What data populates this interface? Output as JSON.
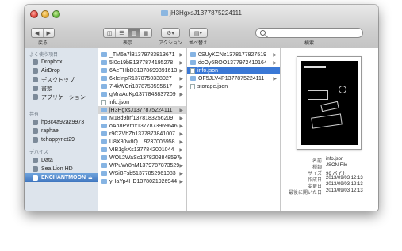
{
  "window": {
    "title": "jH3HgxsJ1377875224111"
  },
  "toolbar": {
    "back_label": "戻る",
    "view_label": "表示",
    "action_label": "アクション",
    "arrange_label": "並べ替え",
    "search_label": "検索",
    "search_placeholder": "",
    "view_buttons": [
      "◫",
      "☰",
      "▥",
      "▦"
    ],
    "view_active_index": 2
  },
  "sidebar": {
    "favorites_header": "よく使う項目",
    "favorites": [
      "Dropbox",
      "AirDrop",
      "デスクトップ",
      "書類",
      "アプリケーション"
    ],
    "shared_header": "共有",
    "shared": [
      "hp3c4a92aa9973",
      "raphael",
      "tchappynet29"
    ],
    "devices_header": "デバイス",
    "devices": [
      "Data",
      "Sea Lion HD",
      "ENCHANTMOON"
    ],
    "selected": "ENCHANTMOON",
    "eject_icon": "⏏"
  },
  "column1": [
    {
      "name": "_TM6a7lB1379783813671",
      "type": "folder"
    },
    {
      "name": "5I0c19bE1377874195278",
      "type": "folder"
    },
    {
      "name": "6AeTHbD31378699391613",
      "type": "folder"
    },
    {
      "name": "6xIeInpR1378750338027",
      "type": "folder"
    },
    {
      "name": "7j4kWCri1378750595617",
      "type": "folder"
    },
    {
      "name": "gMraAuKp1377843837209",
      "type": "folder"
    },
    {
      "name": "info.json",
      "type": "file"
    },
    {
      "name": "jH3HgxsJ1377875224111",
      "type": "folder",
      "selected": "gray"
    },
    {
      "name": "M18d9brf1378183256209",
      "type": "folder"
    },
    {
      "name": "oAh8PVmx1377873969646",
      "type": "folder"
    },
    {
      "name": "r9CZVbZb1377873841007",
      "type": "folder"
    },
    {
      "name": "U8X80w8Q....9237005958",
      "type": "folder"
    },
    {
      "name": "VIB1gkXs1377842001044",
      "type": "folder"
    },
    {
      "name": "WOL2WaSc1378203848597",
      "type": "folder"
    },
    {
      "name": "WPuWr8hM1379787873529",
      "type": "folder"
    },
    {
      "name": "WSiBFsb51377852961083",
      "type": "folder"
    },
    {
      "name": "yHaYp4HD1378021926944",
      "type": "folder"
    }
  ],
  "column2": [
    {
      "name": "0SUyKCNz1378177827519",
      "type": "folder"
    },
    {
      "name": "dcOy6ROO1377972410164",
      "type": "folder"
    },
    {
      "name": "info.json",
      "type": "file",
      "selected": "blue"
    },
    {
      "name": "OF5JLV4P1377875224111",
      "type": "folder"
    },
    {
      "name": "storage.json",
      "type": "file"
    }
  ],
  "preview": {
    "keys": [
      "名前",
      "種類",
      "サイズ",
      "作成日",
      "変更日",
      "最後に開いた日"
    ],
    "values": [
      "info.json",
      "JSON File",
      "96 バイト",
      "2013/09/03 12:13",
      "2013/09/03 12:13",
      "2013/09/03 12:13"
    ]
  },
  "colors": {
    "selection_blue": "#3a78d6",
    "sidebar_bg": "#dde4ec",
    "selection_gray": "#d5d5d5"
  }
}
